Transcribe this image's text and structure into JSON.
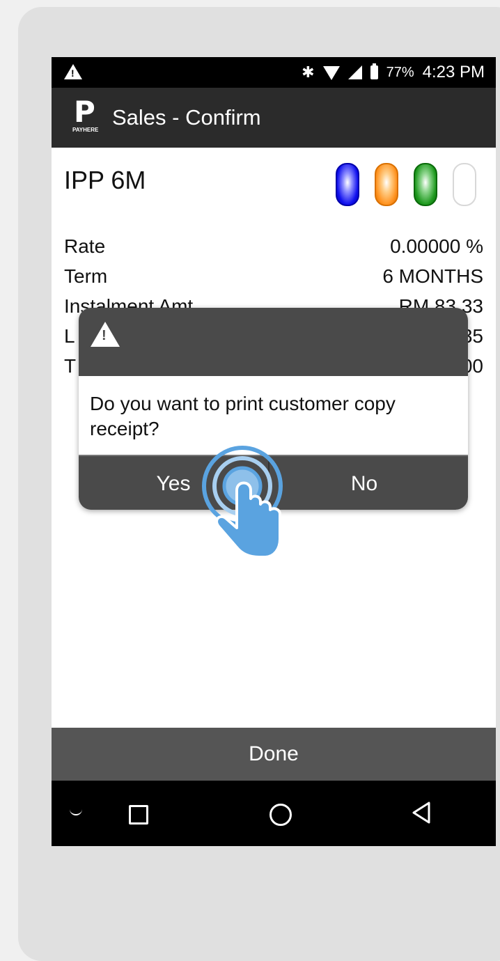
{
  "status_bar": {
    "battery": "77%",
    "time": "4:23 PM"
  },
  "app_bar": {
    "logo_text": "PAYHERE",
    "title": "Sales - Confirm"
  },
  "plan": {
    "name": "IPP 6M",
    "indicator_colors": [
      "#1010ee",
      "#ff9320",
      "#1f9a1f",
      "#ffffff"
    ]
  },
  "details": [
    {
      "label": "Rate",
      "value": "0.00000 %"
    },
    {
      "label": "Term",
      "value": "6 MONTHS"
    },
    {
      "label": "Instalment Amt",
      "value": "RM 83.33"
    },
    {
      "label": "L",
      "value": "35"
    },
    {
      "label": "T",
      "value": "00"
    }
  ],
  "dialog": {
    "message": "Do you want to print customer copy receipt?",
    "yes_label": "Yes",
    "no_label": "No"
  },
  "done_label": "Done"
}
